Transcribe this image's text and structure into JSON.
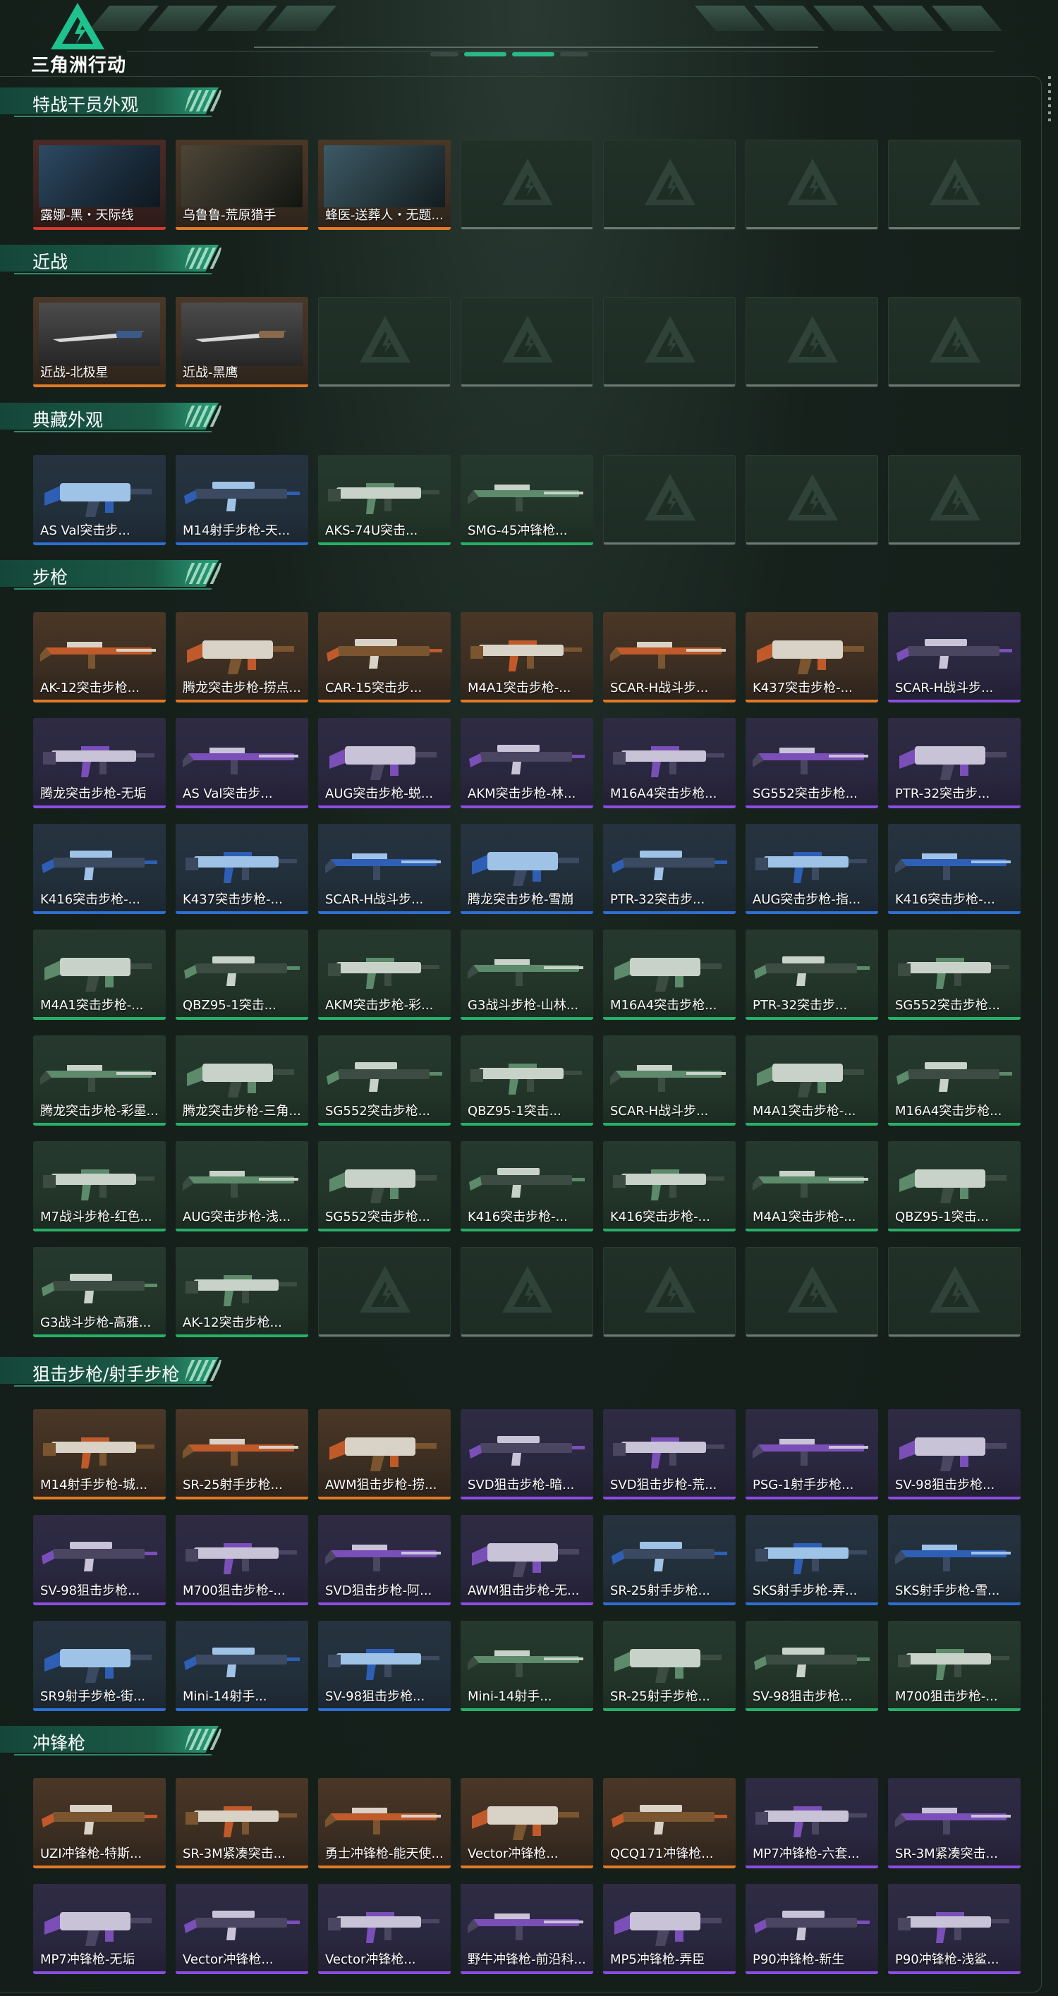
{
  "header": {
    "logo_text": "三角洲行动"
  },
  "sections": [
    {
      "title": "特战干员外观",
      "items": [
        {
          "name": "露娜-黑・天际线",
          "rarity": "red"
        },
        {
          "name": "乌鲁鲁-荒原猎手",
          "rarity": "orange"
        },
        {
          "name": "蜂医-送葬人・无题...",
          "rarity": "orange"
        },
        {
          "name": "",
          "rarity": "empty"
        },
        {
          "name": "",
          "rarity": "empty"
        },
        {
          "name": "",
          "rarity": "empty"
        },
        {
          "name": "",
          "rarity": "empty"
        }
      ]
    },
    {
      "title": "近战",
      "items": [
        {
          "name": "近战-北极星",
          "rarity": "orange"
        },
        {
          "name": "近战-黑鹰",
          "rarity": "orange"
        },
        {
          "name": "",
          "rarity": "empty"
        },
        {
          "name": "",
          "rarity": "empty"
        },
        {
          "name": "",
          "rarity": "empty"
        },
        {
          "name": "",
          "rarity": "empty"
        },
        {
          "name": "",
          "rarity": "empty"
        }
      ]
    },
    {
      "title": "典藏外观",
      "items": [
        {
          "name": "AS Val突击步...",
          "rarity": "blue"
        },
        {
          "name": "M14射手步枪-天...",
          "rarity": "blue"
        },
        {
          "name": "AKS-74U突击...",
          "rarity": "green"
        },
        {
          "name": "SMG-45冲锋枪...",
          "rarity": "green"
        },
        {
          "name": "",
          "rarity": "empty"
        },
        {
          "name": "",
          "rarity": "empty"
        },
        {
          "name": "",
          "rarity": "empty"
        }
      ]
    },
    {
      "title": "步枪",
      "items": [
        {
          "name": "AK-12突击步枪...",
          "rarity": "orange"
        },
        {
          "name": "腾龙突击步枪-捞点...",
          "rarity": "orange"
        },
        {
          "name": "CAR-15突击步...",
          "rarity": "orange"
        },
        {
          "name": "M4A1突击步枪-...",
          "rarity": "orange"
        },
        {
          "name": "SCAR-H战斗步...",
          "rarity": "orange"
        },
        {
          "name": "K437突击步枪-...",
          "rarity": "orange"
        },
        {
          "name": "SCAR-H战斗步...",
          "rarity": "purple"
        },
        {
          "name": "腾龙突击步枪-无垢",
          "rarity": "purple"
        },
        {
          "name": "AS Val突击步...",
          "rarity": "purple"
        },
        {
          "name": "AUG突击步枪-蜕...",
          "rarity": "purple"
        },
        {
          "name": "AKM突击步枪-林...",
          "rarity": "purple"
        },
        {
          "name": "M16A4突击步枪...",
          "rarity": "purple"
        },
        {
          "name": "SG552突击步枪...",
          "rarity": "purple"
        },
        {
          "name": "PTR-32突击步...",
          "rarity": "purple"
        },
        {
          "name": "K416突击步枪-...",
          "rarity": "blue"
        },
        {
          "name": "K437突击步枪-...",
          "rarity": "blue"
        },
        {
          "name": "SCAR-H战斗步...",
          "rarity": "blue"
        },
        {
          "name": "腾龙突击步枪-雪崩",
          "rarity": "blue"
        },
        {
          "name": "PTR-32突击步...",
          "rarity": "blue"
        },
        {
          "name": "AUG突击步枪-指...",
          "rarity": "blue"
        },
        {
          "name": "K416突击步枪-...",
          "rarity": "blue"
        },
        {
          "name": "M4A1突击步枪-...",
          "rarity": "green"
        },
        {
          "name": "QBZ95-1突击...",
          "rarity": "green"
        },
        {
          "name": "AKM突击步枪-彩...",
          "rarity": "green"
        },
        {
          "name": "G3战斗步枪-山林...",
          "rarity": "green"
        },
        {
          "name": "M16A4突击步枪...",
          "rarity": "green"
        },
        {
          "name": "PTR-32突击步...",
          "rarity": "green"
        },
        {
          "name": "SG552突击步枪...",
          "rarity": "green"
        },
        {
          "name": "腾龙突击步枪-彩墨...",
          "rarity": "green"
        },
        {
          "name": "腾龙突击步枪-三角...",
          "rarity": "green"
        },
        {
          "name": "SG552突击步枪...",
          "rarity": "green"
        },
        {
          "name": "QBZ95-1突击...",
          "rarity": "green"
        },
        {
          "name": "SCAR-H战斗步...",
          "rarity": "green"
        },
        {
          "name": "M4A1突击步枪-...",
          "rarity": "green"
        },
        {
          "name": "M16A4突击步枪...",
          "rarity": "green"
        },
        {
          "name": "M7战斗步枪-红色...",
          "rarity": "green"
        },
        {
          "name": "AUG突击步枪-浅...",
          "rarity": "green"
        },
        {
          "name": "SG552突击步枪...",
          "rarity": "green"
        },
        {
          "name": "K416突击步枪-...",
          "rarity": "green"
        },
        {
          "name": "K416突击步枪-...",
          "rarity": "green"
        },
        {
          "name": "M4A1突击步枪-...",
          "rarity": "green"
        },
        {
          "name": "QBZ95-1突击...",
          "rarity": "green"
        },
        {
          "name": "G3战斗步枪-高雅...",
          "rarity": "green"
        },
        {
          "name": "AK-12突击步枪...",
          "rarity": "green"
        },
        {
          "name": "",
          "rarity": "empty"
        },
        {
          "name": "",
          "rarity": "empty"
        },
        {
          "name": "",
          "rarity": "empty"
        },
        {
          "name": "",
          "rarity": "empty"
        },
        {
          "name": "",
          "rarity": "empty"
        }
      ]
    },
    {
      "title": "狙击步枪/射手步枪",
      "items": [
        {
          "name": "M14射手步枪-城...",
          "rarity": "orange"
        },
        {
          "name": "SR-25射手步枪...",
          "rarity": "orange"
        },
        {
          "name": "AWM狙击步枪-捞...",
          "rarity": "orange"
        },
        {
          "name": "SVD狙击步枪-暗...",
          "rarity": "purple"
        },
        {
          "name": "SVD狙击步枪-荒...",
          "rarity": "purple"
        },
        {
          "name": "PSG-1射手步枪...",
          "rarity": "purple"
        },
        {
          "name": "SV-98狙击步枪...",
          "rarity": "purple"
        },
        {
          "name": "SV-98狙击步枪...",
          "rarity": "purple"
        },
        {
          "name": "M700狙击步枪-...",
          "rarity": "purple"
        },
        {
          "name": "SVD狙击步枪-阿...",
          "rarity": "purple"
        },
        {
          "name": "AWM狙击步枪-无...",
          "rarity": "purple"
        },
        {
          "name": "SR-25射手步枪...",
          "rarity": "blue"
        },
        {
          "name": "SKS射手步枪-弄...",
          "rarity": "blue"
        },
        {
          "name": "SKS射手步枪-雪...",
          "rarity": "blue"
        },
        {
          "name": "SR9射手步枪-街...",
          "rarity": "blue"
        },
        {
          "name": "Mini-14射手...",
          "rarity": "blue"
        },
        {
          "name": "SV-98狙击步枪...",
          "rarity": "blue"
        },
        {
          "name": "Mini-14射手...",
          "rarity": "green"
        },
        {
          "name": "SR-25射手步枪...",
          "rarity": "green"
        },
        {
          "name": "SV-98狙击步枪...",
          "rarity": "green"
        },
        {
          "name": "M700狙击步枪-...",
          "rarity": "green"
        }
      ]
    },
    {
      "title": "冲锋枪",
      "items": [
        {
          "name": "UZI冲锋枪-特斯...",
          "rarity": "orange"
        },
        {
          "name": "SR-3M紧凑突击...",
          "rarity": "orange"
        },
        {
          "name": "勇士冲锋枪-能天使...",
          "rarity": "orange"
        },
        {
          "name": "Vector冲锋枪...",
          "rarity": "orange"
        },
        {
          "name": "QCQ171冲锋枪...",
          "rarity": "orange"
        },
        {
          "name": "MP7冲锋枪-六套...",
          "rarity": "purple"
        },
        {
          "name": "SR-3M紧凑突击...",
          "rarity": "purple"
        },
        {
          "name": "MP7冲锋枪-无垢",
          "rarity": "purple"
        },
        {
          "name": "Vector冲锋枪...",
          "rarity": "purple"
        },
        {
          "name": "Vector冲锋枪...",
          "rarity": "purple"
        },
        {
          "name": "野牛冲锋枪-前沿科...",
          "rarity": "purple"
        },
        {
          "name": "MP5冲锋枪-弄臣",
          "rarity": "purple"
        },
        {
          "name": "P90冲锋枪-新生",
          "rarity": "purple"
        },
        {
          "name": "P90冲锋枪-浅鲨...",
          "rarity": "purple"
        }
      ]
    }
  ],
  "colors": {
    "red": "#d13a2d",
    "orange": "#e07a26",
    "purple": "#8a4ee0",
    "blue": "#2f6fd4",
    "green": "#27b068",
    "accent": "#2bb88b"
  },
  "icons": [
    "delta-logo-icon",
    "weapon-image",
    "agent-portrait-image",
    "knife-image",
    "empty-slot-icon"
  ]
}
